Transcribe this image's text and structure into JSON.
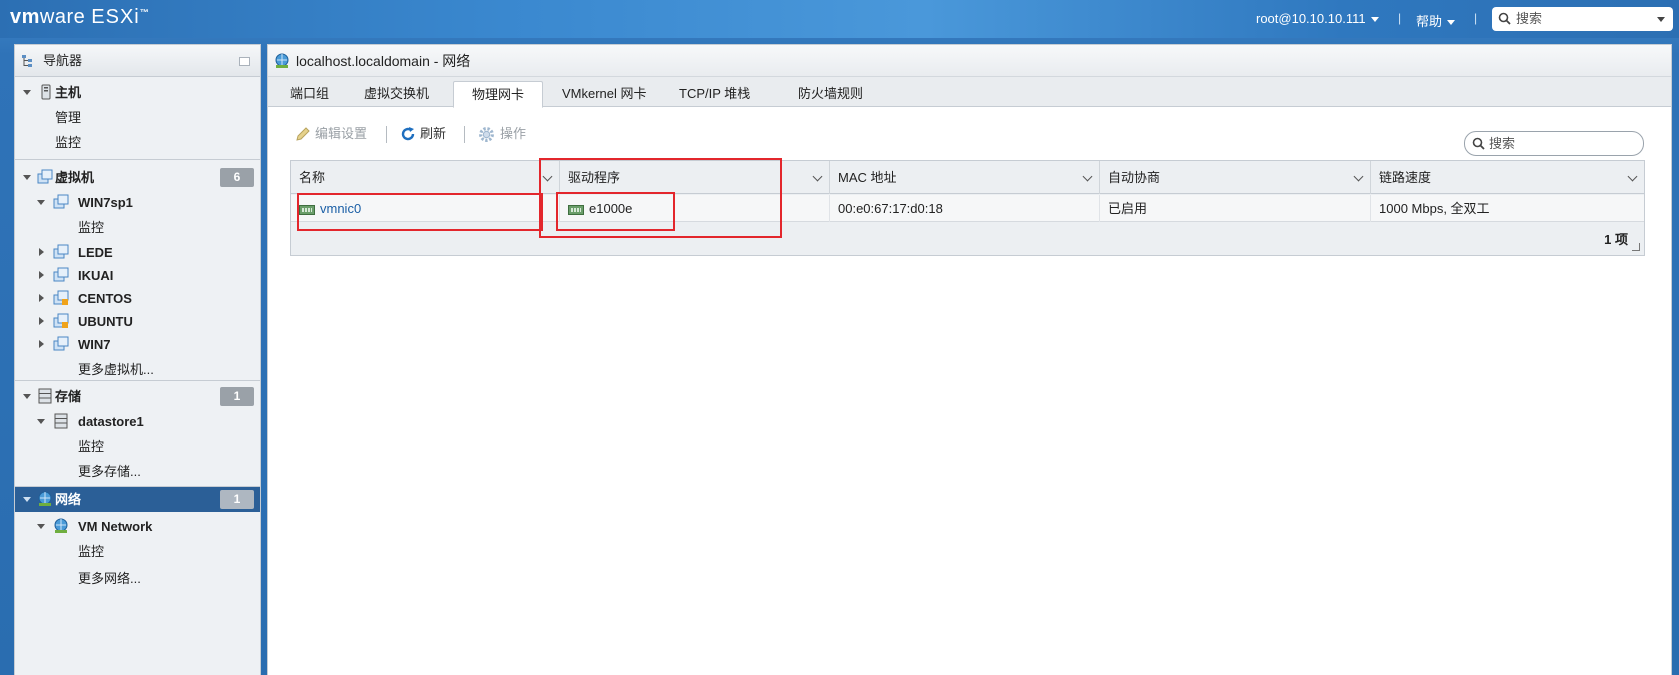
{
  "header": {
    "logo_vm": "vm",
    "logo_ware": "ware",
    "logo_product": "ESXi",
    "logo_tm": "™",
    "user": "root@10.10.10.111",
    "help": "帮助",
    "separator": "|",
    "search_placeholder": "搜索"
  },
  "navigator": {
    "title": "导航器",
    "host": {
      "label": "主机",
      "children": [
        "管理",
        "监控"
      ]
    },
    "vms": {
      "label": "虚拟机",
      "count": "6",
      "items": [
        {
          "label": "WIN7sp1",
          "expanded": true,
          "children": [
            "监控"
          ]
        },
        {
          "label": "LEDE"
        },
        {
          "label": "IKUAI"
        },
        {
          "label": "CENTOS"
        },
        {
          "label": "UBUNTU"
        },
        {
          "label": "WIN7"
        }
      ],
      "more": "更多虚拟机..."
    },
    "storage": {
      "label": "存储",
      "count": "1",
      "items": [
        {
          "label": "datastore1",
          "children": [
            "监控"
          ]
        }
      ],
      "more": "更多存储..."
    },
    "network": {
      "label": "网络",
      "count": "1",
      "selected": true,
      "items": [
        {
          "label": "VM Network",
          "children": [
            "监控"
          ]
        }
      ],
      "more": "更多网络..."
    }
  },
  "main": {
    "title": "localhost.localdomain - 网络",
    "tabs": [
      "端口组",
      "虚拟交换机",
      "物理网卡",
      "VMkernel 网卡",
      "TCP/IP 堆栈",
      "防火墙规则"
    ],
    "active_tab": "物理网卡",
    "toolbar": {
      "edit": "编辑设置",
      "refresh": "刷新",
      "actions": "操作"
    },
    "search_placeholder": "搜索",
    "grid": {
      "columns": [
        "名称",
        "驱动程序",
        "MAC 地址",
        "自动协商",
        "链路速度"
      ],
      "rows": [
        {
          "name": "vmnic0",
          "driver": "e1000e",
          "mac": "00:e0:67:17:d0:18",
          "autoneg": "已启用",
          "speed": "1000 Mbps, 全双工"
        }
      ],
      "footer": "1 项"
    }
  },
  "colors": {
    "header_blue": "#3a88cf",
    "selected_nav": "#2b5f97",
    "link": "#1b5fa6",
    "annotation_red": "#e3262c"
  }
}
